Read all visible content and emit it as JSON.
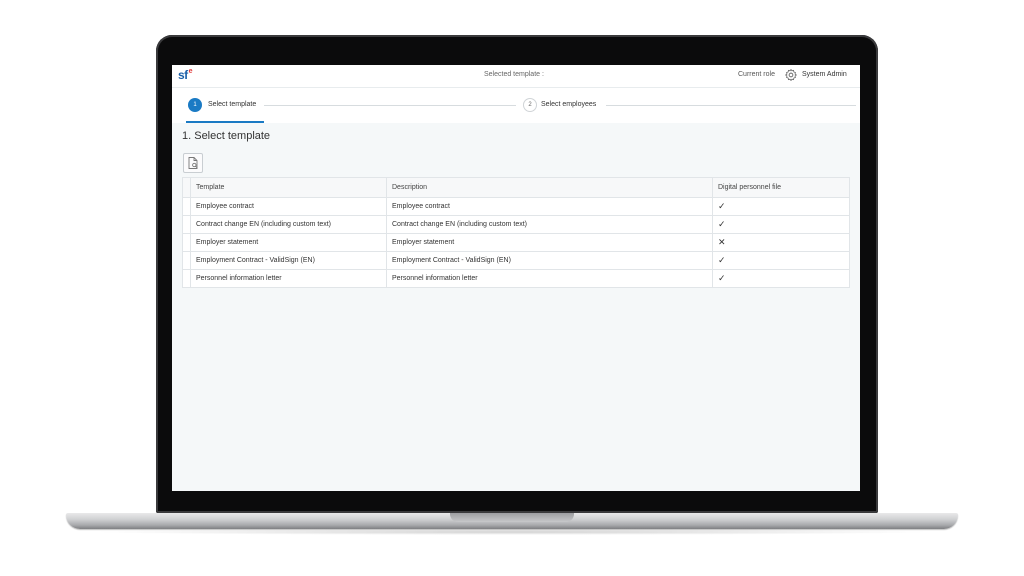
{
  "header": {
    "logo_text": "sf",
    "logo_sup": "e",
    "selected_template_label": "Selected template :",
    "role_label": "Current role",
    "role_value": "System Admin",
    "gear_icon": "gear-icon"
  },
  "stepper": {
    "steps": [
      {
        "number": "1",
        "label": "Select template",
        "active": true
      },
      {
        "number": "2",
        "label": "Select employees",
        "active": false
      }
    ],
    "accent": "#1a7ac4"
  },
  "section": {
    "title": "1. Select template"
  },
  "toolbar": {
    "preview_icon": "document-search-icon"
  },
  "table": {
    "columns": [
      "Template",
      "Description",
      "Digital personnel file"
    ],
    "rows": [
      {
        "template": "Employee contract",
        "description": "Employee contract",
        "digital": "✓"
      },
      {
        "template": "Contract change EN (including custom text)",
        "description": "Contract change EN (including custom text)",
        "digital": "✓"
      },
      {
        "template": "Employer statement",
        "description": "Employer statement",
        "digital": "✕"
      },
      {
        "template": "Employment Contract - ValidSign (EN)",
        "description": "Employment Contract - ValidSign (EN)",
        "digital": "✓"
      },
      {
        "template": "Personnel information letter",
        "description": "Personnel information letter",
        "digital": "✓"
      }
    ]
  }
}
